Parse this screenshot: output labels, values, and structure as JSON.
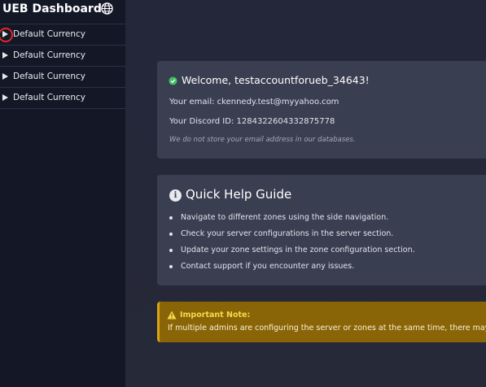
{
  "sidebar": {
    "title": "UEB Dashboard",
    "language_icon": "globe-icon",
    "items": [
      {
        "label": "Default Currency"
      },
      {
        "label": "Default Currency"
      },
      {
        "label": "Default Currency"
      },
      {
        "label": "Default Currency"
      }
    ]
  },
  "welcome": {
    "title": "Welcome, testaccountforueb_34643!",
    "email": "Your email: ckennedy.test@myyahoo.com",
    "discord": "Your Discord ID: 1284322604332875778",
    "privacy_note": "We do not store your email address in our databases."
  },
  "help": {
    "title": "Quick Help Guide",
    "items": [
      "Navigate to different zones using the side navigation.",
      "Check your server configurations in the server section.",
      "Update your zone settings in the zone configuration section.",
      "Contact support if you encounter any issues."
    ]
  },
  "important": {
    "title": "Important Note:",
    "text": "If multiple admins are configuring the server or zones at the same time, there may be er"
  },
  "colors": {
    "sidebar_bg": "#141726",
    "main_bg": "#24273a",
    "card_bg": "#3a3e51",
    "success": "#3fbf60",
    "warning_bg": "#8a6508",
    "warning_title": "#f8d94a",
    "active_ring": "#e02828"
  }
}
